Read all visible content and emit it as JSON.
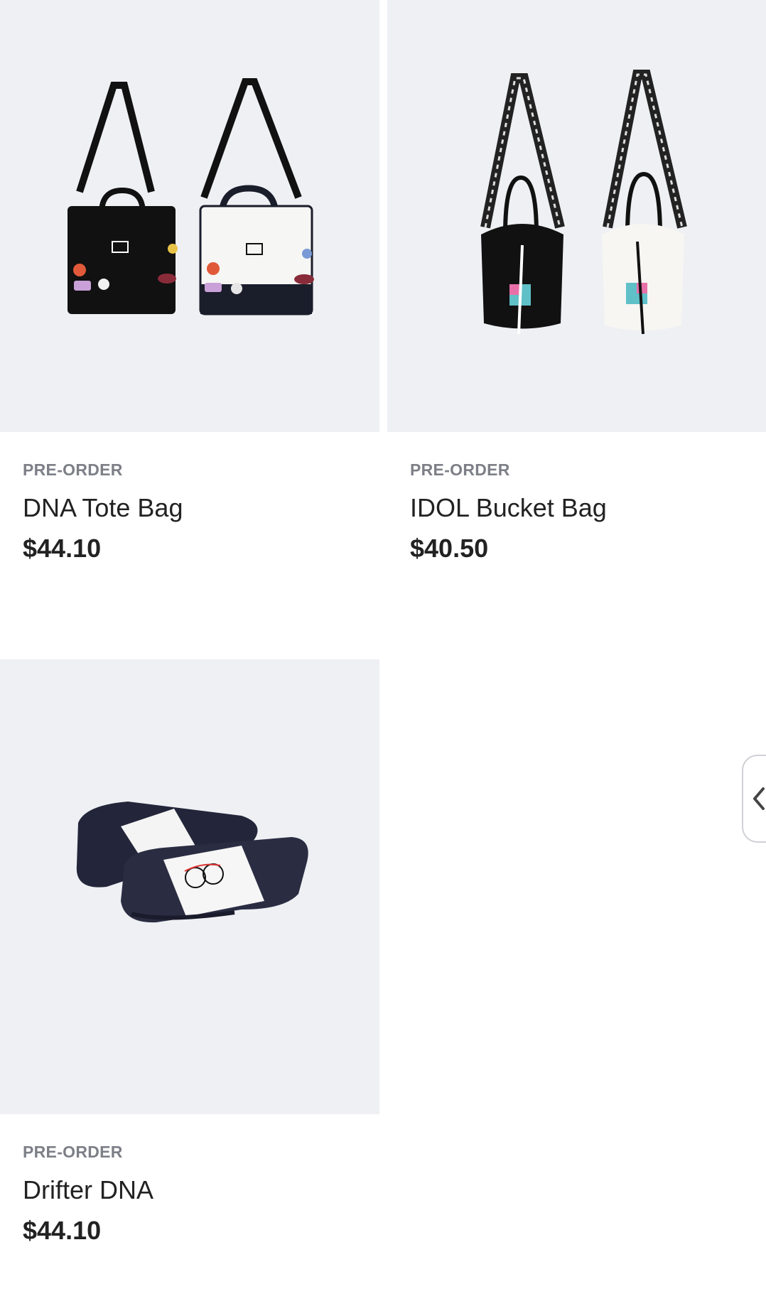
{
  "products": [
    {
      "badge": "PRE-ORDER",
      "name": "DNA Tote Bag",
      "price": "$44.10",
      "image": "dna-tote-bag-image"
    },
    {
      "badge": "PRE-ORDER",
      "name": "IDOL Bucket Bag",
      "price": "$40.50",
      "image": "idol-bucket-bag-image"
    },
    {
      "badge": "PRE-ORDER",
      "name": "Drifter DNA",
      "price": "$44.10",
      "image": "drifter-dna-slides-image"
    }
  ],
  "side_tab": {
    "icon": "chevron-left-icon"
  },
  "colors": {
    "image_bg": "#eef0f4",
    "badge": "#7d7f87",
    "text": "#222222"
  }
}
